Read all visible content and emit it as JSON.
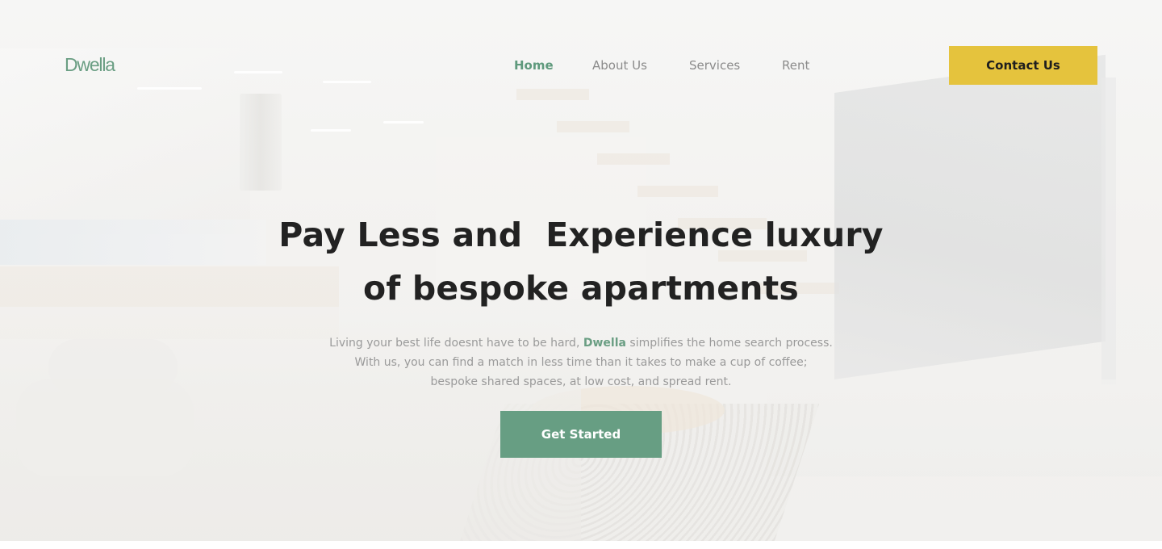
{
  "brand": {
    "logo_text": "Dwella",
    "accent_color": "#679e83",
    "cta_yellow": "#e5c33d"
  },
  "nav": {
    "items": [
      {
        "label": "Home",
        "active": true
      },
      {
        "label": "About Us",
        "active": false
      },
      {
        "label": "Services",
        "active": false
      },
      {
        "label": "Rent",
        "active": false
      }
    ],
    "contact_label": "Contact Us"
  },
  "hero": {
    "headline_line1": "Pay Less and  Experience luxury",
    "headline_line2": "of bespoke apartments",
    "subtitle_line1_before": "Living your best life doesnt have to be hard, ",
    "subtitle_brand": "Dwella",
    "subtitle_line1_after": " simplifies the home search process.",
    "subtitle_line2": "With us, you can find a match in less time than it takes to make a cup of coffee;",
    "subtitle_line3": "bespoke shared spaces, at low cost, and spread rent.",
    "cta_label": "Get Started"
  }
}
